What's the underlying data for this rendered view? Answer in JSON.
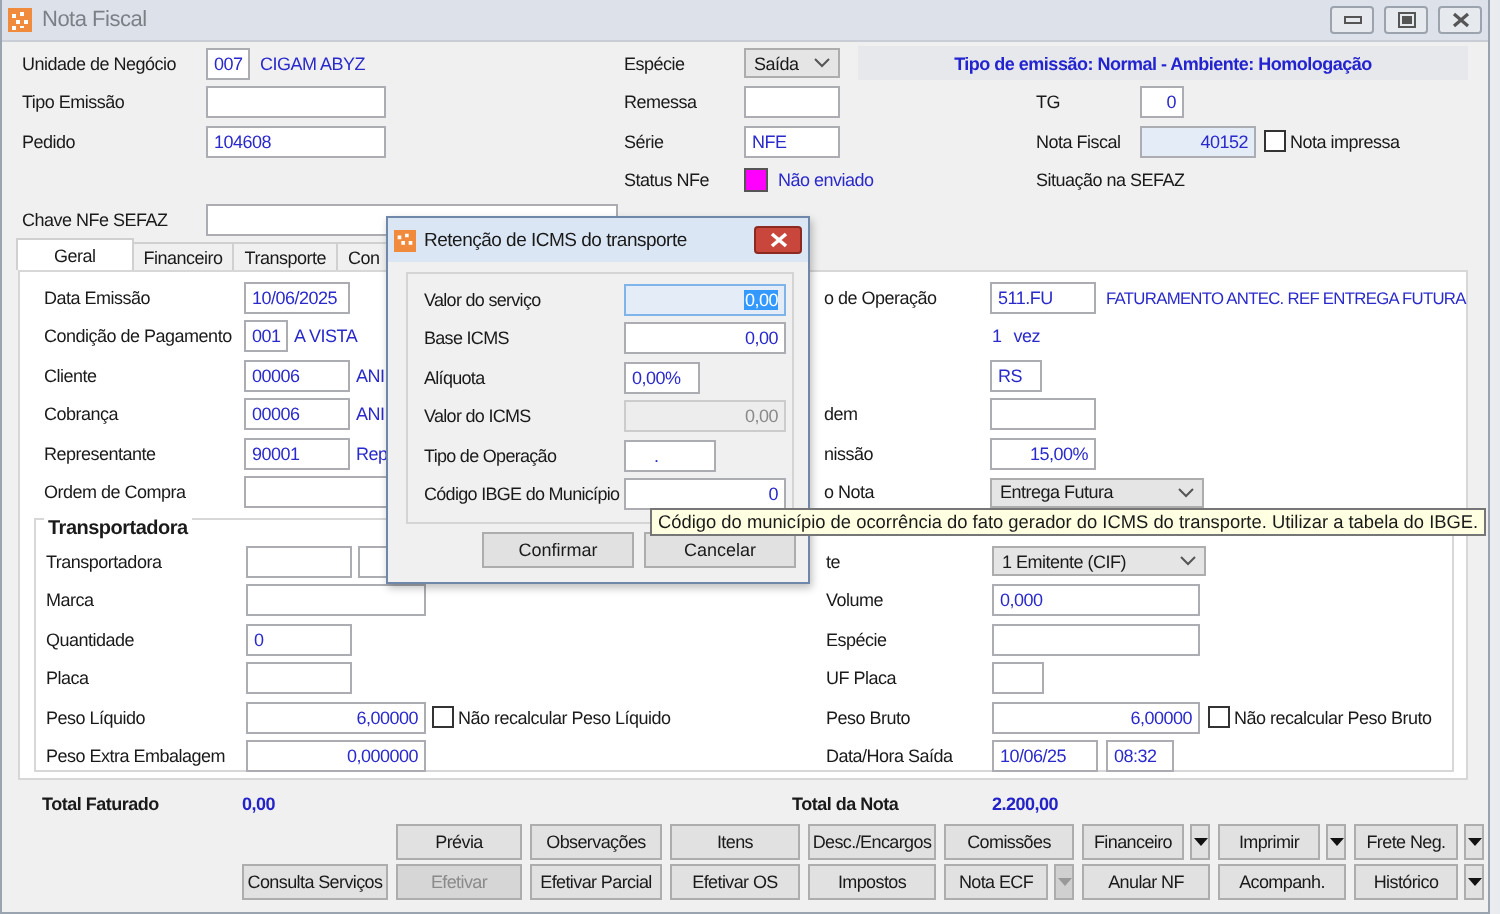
{
  "window": {
    "title": "Nota Fiscal"
  },
  "top": {
    "left": [
      {
        "label": "Unidade de Negócio",
        "widgets": [
          {
            "kind": "short",
            "value": "007"
          },
          {
            "kind": "note",
            "value": "CIGAM ABYZ"
          }
        ]
      },
      {
        "label": "Tipo Emissão",
        "widgets": [
          {
            "kind": "long"
          }
        ]
      },
      {
        "label": "Pedido",
        "widgets": [
          {
            "kind": "long",
            "value": "104608"
          }
        ]
      }
    ],
    "middle": [
      {
        "label": "Espécie",
        "widgets": [
          {
            "kind": "select",
            "value": "Saída"
          }
        ]
      },
      {
        "label": "Remessa",
        "widgets": [
          {
            "kind": "field"
          }
        ]
      },
      {
        "label": "Série",
        "widgets": [
          {
            "kind": "field",
            "value": "NFE"
          }
        ]
      },
      {
        "label": "Status NFe",
        "widgets": [
          {
            "kind": "swatch",
            "color": "#ff00ff"
          },
          {
            "kind": "note",
            "value": "Não enviado"
          }
        ]
      }
    ],
    "banner": "Tipo de emissão: Normal - Ambiente: Homologação",
    "right": [
      {
        "label": "TG",
        "widgets": [
          {
            "kind": "short",
            "value": "0",
            "numeric": true
          }
        ]
      },
      {
        "label": "Nota Fiscal",
        "widgets": [
          {
            "kind": "field",
            "value": "40152",
            "numeric": true,
            "readonly": true
          },
          {
            "kind": "check",
            "label": "Nota impressa",
            "checked": false
          }
        ]
      },
      {
        "label": "Situação na SEFAZ"
      }
    ],
    "chave": {
      "label": "Chave NFe SEFAZ",
      "widgets": [
        {
          "kind": "wide"
        }
      ]
    }
  },
  "tabs": [
    {
      "label": "Geral",
      "selected": true
    },
    {
      "label": "Financeiro",
      "selected": false
    },
    {
      "label": "Transporte",
      "selected": false
    },
    {
      "label": "Con",
      "selected": false
    }
  ],
  "geral": {
    "rows": [
      {
        "left": {
          "label": "Data Emissão",
          "widgets": [
            {
              "kind": "field",
              "value": "10/06/2025"
            }
          ]
        },
        "right": {
          "label": "o de Operação",
          "widgets": [
            {
              "kind": "field",
              "value": "511.FU"
            },
            {
              "kind": "note",
              "value": "FATURAMENTO ANTEC. REF ENTREGA FUTURA"
            }
          ]
        }
      },
      {
        "left": {
          "label": "Condição de Pagamento",
          "widgets": [
            {
              "kind": "short",
              "value": "001"
            },
            {
              "kind": "note",
              "value": "A VISTA"
            }
          ]
        },
        "right": {
          "widgets": [
            {
              "kind": "note",
              "value": "1"
            },
            {
              "kind": "note",
              "value": "vez"
            }
          ]
        }
      },
      {
        "left": {
          "label": "Cliente",
          "widgets": [
            {
              "kind": "field",
              "value": "00006"
            },
            {
              "kind": "note",
              "value": "ANI"
            }
          ]
        },
        "right": {
          "widgets": [
            {
              "kind": "tiny",
              "value": "RS"
            }
          ]
        }
      },
      {
        "left": {
          "label": "Cobrança",
          "widgets": [
            {
              "kind": "field",
              "value": "00006"
            },
            {
              "kind": "note",
              "value": "ANI"
            }
          ]
        },
        "right": {
          "label": "dem",
          "widgets": [
            {
              "kind": "field"
            }
          ]
        }
      },
      {
        "left": {
          "label": "Representante",
          "widgets": [
            {
              "kind": "field",
              "value": "90001"
            },
            {
              "kind": "note",
              "value": "Rep"
            }
          ]
        },
        "right": {
          "label": "nissão",
          "widgets": [
            {
              "kind": "field",
              "value": "15,00%",
              "numeric": true
            }
          ]
        }
      },
      {
        "left": {
          "label": "Ordem de Compra",
          "widgets": [
            {
              "kind": "wide"
            }
          ]
        },
        "right": {
          "label": "o Nota",
          "widgets": [
            {
              "kind": "select",
              "value": "Entrega Futura"
            }
          ]
        }
      }
    ]
  },
  "transport": {
    "title": "Transportadora",
    "rows": [
      {
        "left": {
          "label": "Transportadora",
          "widgets": [
            {
              "kind": "field"
            },
            {
              "kind": "field"
            }
          ]
        },
        "right": {
          "label": "te",
          "widgets": [
            {
              "kind": "select",
              "value": "1 Emitente (CIF)"
            }
          ]
        }
      },
      {
        "left": {
          "label": "Marca",
          "widgets": [
            {
              "kind": "long"
            }
          ]
        },
        "right": {
          "label": "Volume",
          "widgets": [
            {
              "kind": "long",
              "value": "0,000"
            }
          ]
        }
      },
      {
        "left": {
          "label": "Quantidade",
          "widgets": [
            {
              "kind": "field",
              "value": "0"
            }
          ]
        },
        "right": {
          "label": "Espécie",
          "widgets": [
            {
              "kind": "long"
            }
          ]
        }
      },
      {
        "left": {
          "label": "Placa",
          "widgets": [
            {
              "kind": "field"
            }
          ]
        },
        "right": {
          "label": "UF Placa",
          "widgets": [
            {
              "kind": "tiny"
            }
          ]
        }
      },
      {
        "left": {
          "label": "Peso Líquido",
          "widgets": [
            {
              "kind": "long",
              "value": "6,00000",
              "numeric": true
            },
            {
              "kind": "check",
              "label": "Não recalcular Peso Líquido",
              "checked": false
            }
          ]
        },
        "right": {
          "label": "Peso Bruto",
          "widgets": [
            {
              "kind": "long",
              "value": "6,00000",
              "numeric": true
            },
            {
              "kind": "check",
              "label": "Não recalcular Peso Bruto",
              "checked": false
            }
          ]
        }
      },
      {
        "left": {
          "label": "Peso Extra Embalagem",
          "widgets": [
            {
              "kind": "long",
              "value": "0,000000",
              "numeric": true
            }
          ]
        },
        "right": {
          "label": "Data/Hora Saída",
          "widgets": [
            {
              "kind": "field",
              "value": "10/06/25"
            },
            {
              "kind": "time",
              "value": "08:32"
            }
          ]
        }
      }
    ]
  },
  "totals": [
    {
      "label": "Total Faturado",
      "value": "0,00"
    },
    {
      "label": "Total da Nota",
      "value": "2.200,00"
    }
  ],
  "buttons": [
    [
      {
        "label": "Prévia",
        "disabled": false
      },
      {
        "label": "Observações",
        "disabled": false
      },
      {
        "label": "Itens",
        "disabled": false
      },
      {
        "label": "Desc./Encargos",
        "disabled": false
      },
      {
        "label": "Comissões",
        "disabled": false
      },
      {
        "label": "Financeiro",
        "disabled": false,
        "menu": true,
        "menu_disabled": false
      },
      {
        "label": "Imprimir",
        "disabled": false,
        "menu": true,
        "menu_disabled": false
      },
      {
        "label": "Frete Neg.",
        "disabled": false,
        "menu": true,
        "menu_disabled": false
      }
    ],
    [
      {
        "label": "Consulta Serviços",
        "disabled": false
      },
      {
        "label": "Efetivar",
        "disabled": true
      },
      {
        "label": "Efetivar Parcial",
        "disabled": false
      },
      {
        "label": "Efetivar OS",
        "disabled": false
      },
      {
        "label": "Impostos",
        "disabled": false
      },
      {
        "label": "Nota ECF",
        "disabled": false,
        "menu": true,
        "menu_disabled": true
      },
      {
        "label": "Anular NF",
        "disabled": false
      },
      {
        "label": "Acompanh.",
        "disabled": false
      },
      {
        "label": "Histórico",
        "disabled": false,
        "menu": true,
        "menu_disabled": false
      }
    ]
  ],
  "dialog": {
    "title": "Retenção de ICMS do transporte",
    "fields": [
      {
        "label": "Valor do serviço",
        "value": "0,00",
        "kind": "amount",
        "focused": true,
        "disabled": false
      },
      {
        "label": "Base ICMS",
        "value": "0,00",
        "kind": "amount",
        "focused": false,
        "disabled": false
      },
      {
        "label": "Alíquota",
        "value": "0,00%",
        "kind": "percent",
        "focused": false,
        "disabled": false
      },
      {
        "label": "Valor do ICMS",
        "value": "0,00",
        "kind": "amount",
        "focused": false,
        "disabled": true
      },
      {
        "label": "Tipo de Operação",
        "value": ".",
        "kind": "code",
        "focused": false,
        "disabled": false
      },
      {
        "label": "Código IBGE do Município",
        "value": "0",
        "kind": "amount",
        "focused": false,
        "disabled": false
      }
    ],
    "buttons": [
      "Confirmar",
      "Cancelar"
    ]
  },
  "tooltip": "Código do município de ocorrência do fato gerador do ICMS do transporte. Utilizar a tabela do IBGE."
}
